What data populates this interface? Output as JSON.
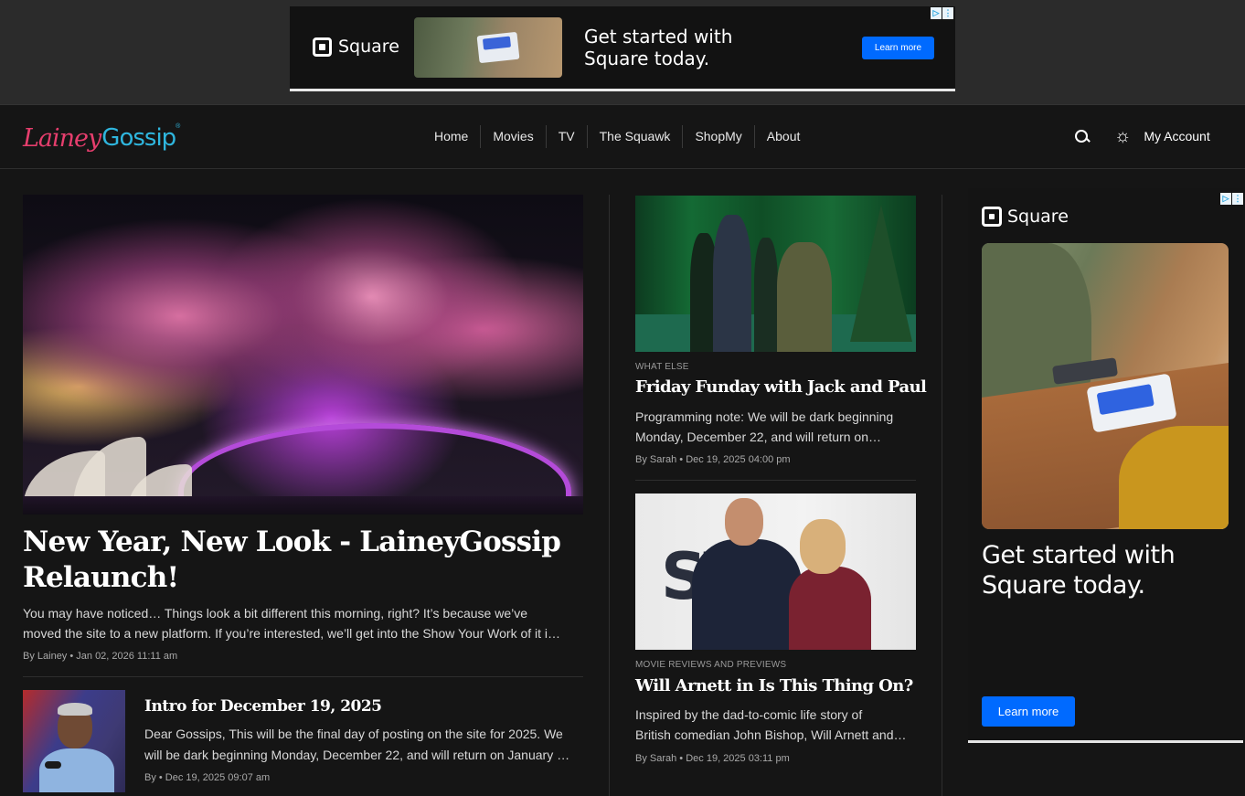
{
  "top_ad": {
    "brand": "Square",
    "headline_line1": "Get started with",
    "headline_line2": "Square today.",
    "cta": "Learn more",
    "adchoice_icons": [
      "adchoices-icon",
      "more-options-icon"
    ]
  },
  "nav": {
    "logo_part1": "Lainey",
    "logo_part2": "Gossip",
    "logo_mark": "®",
    "items": [
      "Home",
      "Movies",
      "TV",
      "The Squawk",
      "ShopMy",
      "About"
    ],
    "search_icon": "search-icon",
    "theme_icon": "sun-icon",
    "account": "My Account"
  },
  "feature": {
    "title": "New Year, New Look - LaineyGossip Relaunch!",
    "excerpt_line1": "You may have noticed… Things look a bit different this morning, right? It’s because we’ve",
    "excerpt_line2": "moved the site to a new platform. If you’re interested, we’ll get into the Show Your Work of it i…",
    "meta": "By Lainey  •  Jan 02, 2026 11:11 am"
  },
  "small_story": {
    "title": "Intro for December 19, 2025",
    "excerpt_line1": "Dear Gossips, This will be the final day of posting on the site for 2025. We",
    "excerpt_line2": "will be dark beginning Monday, December 22, and will return on January …",
    "meta": "By  •  Dec 19, 2025 09:07 am"
  },
  "cards": [
    {
      "kicker": "WHAT ELSE",
      "title": "Friday Funday with Jack and Paul",
      "excerpt_line1": "Programming note: We will be dark beginning",
      "excerpt_line2": "Monday, December 22, and will return on…",
      "meta": "By Sarah  •  Dec 19, 2025 04:00 pm"
    },
    {
      "kicker": "MOVIE REVIEWS AND PREVIEWS",
      "title": "Will Arnett in Is This Thing On?",
      "excerpt_line1": "Inspired by the dad-to-comic life story of",
      "excerpt_line2": "British comedian John Bishop, Will Arnett and…",
      "meta": "By Sarah  •  Dec 19, 2025 03:11 pm",
      "image_backdrop_text": "ST"
    }
  ],
  "side_ad": {
    "brand": "Square",
    "headline_line1": "Get started with",
    "headline_line2": "Square today.",
    "cta": "Learn more"
  },
  "colors": {
    "background": "#151515",
    "ad_band": "#2b2b2b",
    "cta_blue": "#006aff",
    "logo_pink": "#e63e6d",
    "logo_blue": "#2fb6de"
  }
}
